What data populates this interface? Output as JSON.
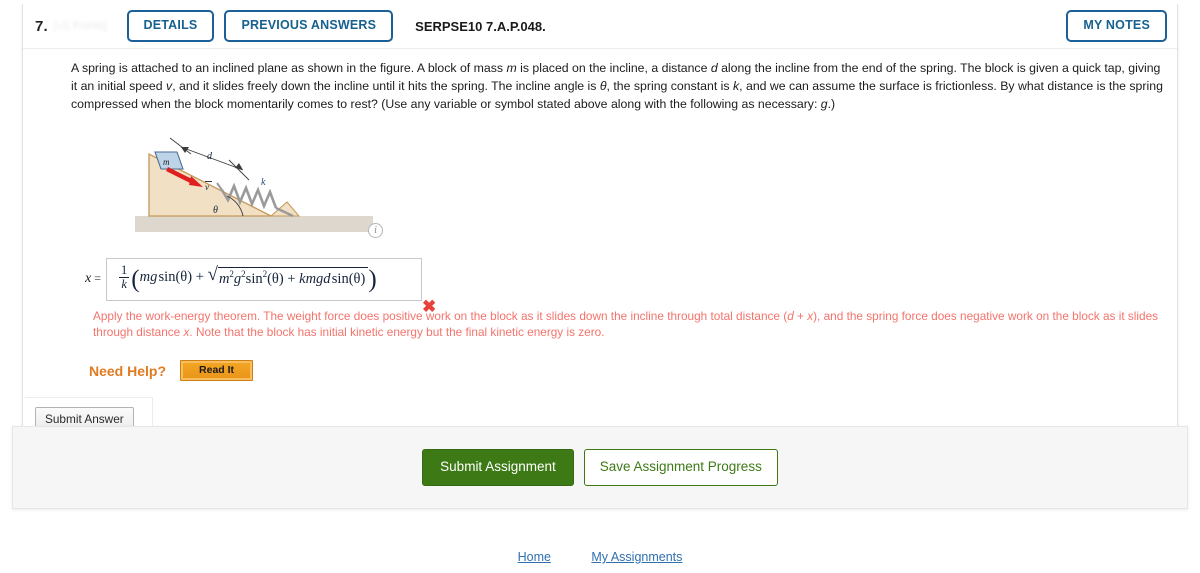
{
  "question": {
    "number": "7.",
    "points_redacted": "[-/1 Points]",
    "buttons": {
      "details": "DETAILS",
      "previous_answers": "PREVIOUS ANSWERS",
      "my_notes": "MY NOTES"
    },
    "code": "SERPSE10 7.A.P.048.",
    "prompt_parts": [
      {
        "t": "A spring is attached to an inclined plane as shown in the figure. A block of mass ",
        "i": false
      },
      {
        "t": "m",
        "i": true
      },
      {
        "t": " is placed on the incline, a distance ",
        "i": false
      },
      {
        "t": "d",
        "i": true
      },
      {
        "t": " along the incline from the end of the spring. The block is given a quick tap, giving it an initial speed ",
        "i": false
      },
      {
        "t": "v",
        "i": true
      },
      {
        "t": ", and it slides freely down the incline until it hits the spring. The incline angle is ",
        "i": false
      },
      {
        "t": "θ",
        "i": true
      },
      {
        "t": ", the spring constant is ",
        "i": false
      },
      {
        "t": "k",
        "i": true
      },
      {
        "t": ", and we can assume the surface is frictionless. By what distance is the spring compressed when the block momentarily comes to rest? (Use any variable or symbol stated above along with the following as necessary: ",
        "i": false
      },
      {
        "t": "g",
        "i": true
      },
      {
        "t": ".)",
        "i": false
      }
    ]
  },
  "figure": {
    "name": "inclined-plane-spring-diagram",
    "labels": {
      "mass": "m",
      "velocity": "v",
      "distance": "d",
      "spring_constant": "k",
      "angle": "θ"
    },
    "colors": {
      "incline": "#efdcc0",
      "incline_edge": "#c49a5a",
      "ground": "#ddd7cd",
      "block": "#bdd3e8",
      "block_edge": "#4a6d93",
      "arrow": "#e02020",
      "spring": "#9a9a9a",
      "label_blue": "#2b4f86"
    },
    "info_icon": "i"
  },
  "answer": {
    "variable": "x",
    "equals": "=",
    "status_icon": "✖",
    "status": "incorrect",
    "expression_plain": "(1/k)(mg sin(θ) + sqrt(m^2 g^2 sin^2(θ) + kmgd sin(θ)))",
    "math": {
      "frac_num": "1",
      "frac_den": "k",
      "open_paren": "(",
      "term1_m": "m",
      "term1_g": "g",
      "term1_sin": "sin",
      "term1_theta": "(θ)",
      "plus1": "+",
      "radical": "√",
      "rad_m": "m",
      "rad_m_sup": "2",
      "rad_g": "g",
      "rad_g_sup": "2",
      "rad_sin": "sin",
      "rad_sin_sup": "2",
      "rad_theta": "(θ)",
      "plus2": "+",
      "rad_kmgd": "kmgd",
      "rad_sin2": "sin",
      "rad_theta2": "(θ)",
      "close_paren": ")"
    }
  },
  "feedback": {
    "parts": [
      {
        "t": "Apply the work-energy theorem. The weight force does positive work on the block as it slides down the incline through total distance (",
        "i": false
      },
      {
        "t": "d",
        "i": true
      },
      {
        "t": " + ",
        "i": false
      },
      {
        "t": "x",
        "i": true
      },
      {
        "t": "), and the spring force does negative work on the block as it slides through distance ",
        "i": false
      },
      {
        "t": "x",
        "i": true
      },
      {
        "t": ". Note that the block has initial kinetic energy but the final kinetic energy is zero.",
        "i": false
      }
    ]
  },
  "need_help": {
    "label": "Need Help?",
    "read_it": "Read It"
  },
  "submit_answer": "Submit Answer",
  "bottom_panel": {
    "submit_assignment": "Submit Assignment",
    "save_progress": "Save Assignment Progress"
  },
  "footer": {
    "home": "Home",
    "my_assignments": "My Assignments"
  }
}
